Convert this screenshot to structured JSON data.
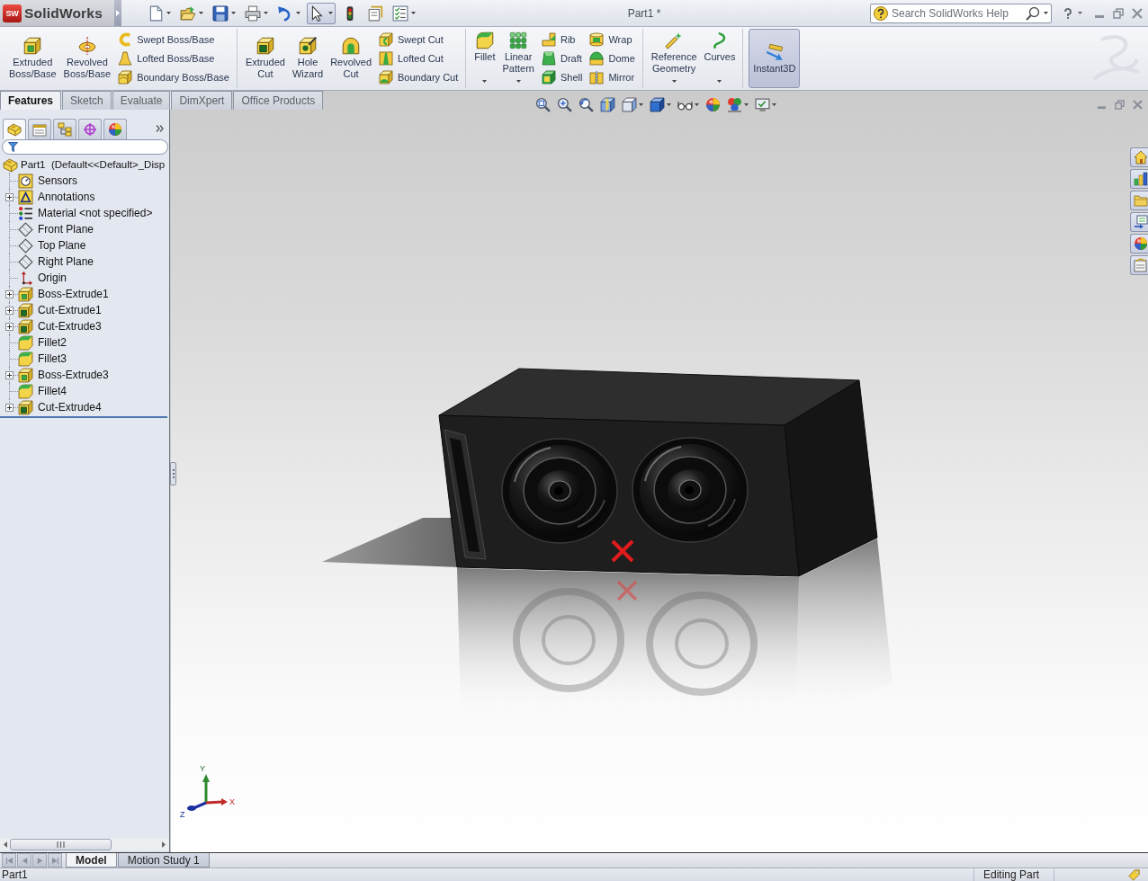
{
  "window": {
    "logo_badge": "SW",
    "app_name": "SolidWorks",
    "title": "Part1 *"
  },
  "quick_access": [
    {
      "has_menu": true,
      "pressed": false
    },
    {
      "has_menu": true,
      "pressed": false
    },
    {
      "has_menu": true,
      "pressed": false
    },
    {
      "has_menu": true,
      "pressed": false
    },
    {
      "has_menu": true,
      "pressed": false
    },
    {
      "has_menu": true,
      "pressed": true
    },
    {
      "has_menu": false,
      "pressed": false
    },
    {
      "has_menu": false,
      "pressed": false
    },
    {
      "has_menu": true,
      "pressed": false
    }
  ],
  "search": {
    "placeholder": "Search SolidWorks Help"
  },
  "command_manager": {
    "groups": [
      {
        "items": [
          {
            "kind": "large",
            "label": "Extruded Boss/Base",
            "has_menu": false,
            "pressed": false
          },
          {
            "kind": "large",
            "label": "Revolved Boss/Base",
            "has_menu": false,
            "pressed": false
          },
          {
            "kind": "stack",
            "items": [
              {
                "label": "Swept Boss/Base",
                "pressed": false
              },
              {
                "label": "Lofted Boss/Base",
                "pressed": false
              },
              {
                "label": "Boundary Boss/Base",
                "pressed": false
              }
            ]
          }
        ]
      },
      {
        "items": [
          {
            "kind": "large",
            "label": "Extruded Cut",
            "has_menu": false,
            "pressed": false
          },
          {
            "kind": "large",
            "label": "Hole Wizard",
            "has_menu": false,
            "pressed": false
          },
          {
            "kind": "large",
            "label": "Revolved Cut",
            "has_menu": false,
            "pressed": false
          },
          {
            "kind": "stack",
            "items": [
              {
                "label": "Swept Cut",
                "pressed": false
              },
              {
                "label": "Lofted Cut",
                "pressed": false
              },
              {
                "label": "Boundary Cut",
                "pressed": false
              }
            ]
          }
        ]
      },
      {
        "items": [
          {
            "kind": "large",
            "label": "Fillet",
            "has_menu": true,
            "pressed": false
          },
          {
            "kind": "large",
            "label": "Linear Pattern",
            "has_menu": true,
            "pressed": false
          },
          {
            "kind": "stack",
            "items": [
              {
                "label": "Rib",
                "pressed": false
              },
              {
                "label": "Draft",
                "pressed": false
              },
              {
                "label": "Shell",
                "pressed": false
              }
            ]
          },
          {
            "kind": "stack",
            "items": [
              {
                "label": "Wrap",
                "pressed": false
              },
              {
                "label": "Dome",
                "pressed": false
              },
              {
                "label": "Mirror",
                "pressed": false
              }
            ]
          }
        ]
      },
      {
        "items": [
          {
            "kind": "large",
            "label": "Reference Geometry",
            "has_menu": true,
            "pressed": false
          },
          {
            "kind": "large",
            "label": "Curves",
            "has_menu": true,
            "pressed": false
          }
        ]
      },
      {
        "items": [
          {
            "kind": "large",
            "label": "Instant3D",
            "has_menu": false,
            "pressed": true
          }
        ]
      }
    ]
  },
  "tabs": [
    {
      "label": "Features",
      "selected": true
    },
    {
      "label": "Sketch",
      "selected": false
    },
    {
      "label": "Evaluate",
      "selected": false
    },
    {
      "label": "DimXpert",
      "selected": false
    },
    {
      "label": "Office Products",
      "selected": false
    }
  ],
  "feature_manager": {
    "panel_tabs": [
      {
        "selected": true
      },
      {
        "selected": false
      },
      {
        "selected": false
      },
      {
        "selected": false
      },
      {
        "selected": false
      }
    ],
    "tree": {
      "root": {
        "label": "Part1  (Default<<Default>_Disp",
        "kind": "part",
        "expandable": false,
        "children": [
          {
            "label": "Sensors",
            "kind": "sensors",
            "expandable": false
          },
          {
            "label": "Annotations",
            "kind": "annotations",
            "expandable": true
          },
          {
            "label": "Material <not specified>",
            "kind": "material",
            "expandable": false
          },
          {
            "label": "Front Plane",
            "kind": "plane",
            "expandable": false
          },
          {
            "label": "Top Plane",
            "kind": "plane",
            "expandable": false
          },
          {
            "label": "Right Plane",
            "kind": "plane",
            "expandable": false
          },
          {
            "label": "Origin",
            "kind": "origin",
            "expandable": false
          },
          {
            "label": "Boss-Extrude1",
            "kind": "boss",
            "expandable": true
          },
          {
            "label": "Cut-Extrude1",
            "kind": "cut",
            "expandable": true
          },
          {
            "label": "Cut-Extrude3",
            "kind": "cut",
            "expandable": true
          },
          {
            "label": "Fillet2",
            "kind": "fillet",
            "expandable": false
          },
          {
            "label": "Fillet3",
            "kind": "fillet",
            "expandable": false
          },
          {
            "label": "Boss-Extrude3",
            "kind": "boss",
            "expandable": true
          },
          {
            "label": "Fillet4",
            "kind": "fillet",
            "expandable": false
          },
          {
            "label": "Cut-Extrude4",
            "kind": "cut",
            "expandable": true
          }
        ]
      }
    }
  },
  "view_toolbar": [
    {
      "has_menu": false
    },
    {
      "has_menu": false
    },
    {
      "has_menu": false
    },
    {
      "has_menu": false
    },
    {
      "has_menu": true
    },
    {
      "has_menu": true
    },
    {
      "has_menu": true
    },
    {
      "has_menu": false
    },
    {
      "has_menu": true
    },
    {
      "has_menu": true
    }
  ],
  "triad": {
    "x_label": "X",
    "y_label": "Y",
    "z_label": "Z"
  },
  "model_tabs": [
    {
      "label": "Model",
      "selected": true
    },
    {
      "label": "Motion Study 1",
      "selected": false
    }
  ],
  "status_bar": {
    "document": "Part1",
    "mode": "Editing Part"
  }
}
